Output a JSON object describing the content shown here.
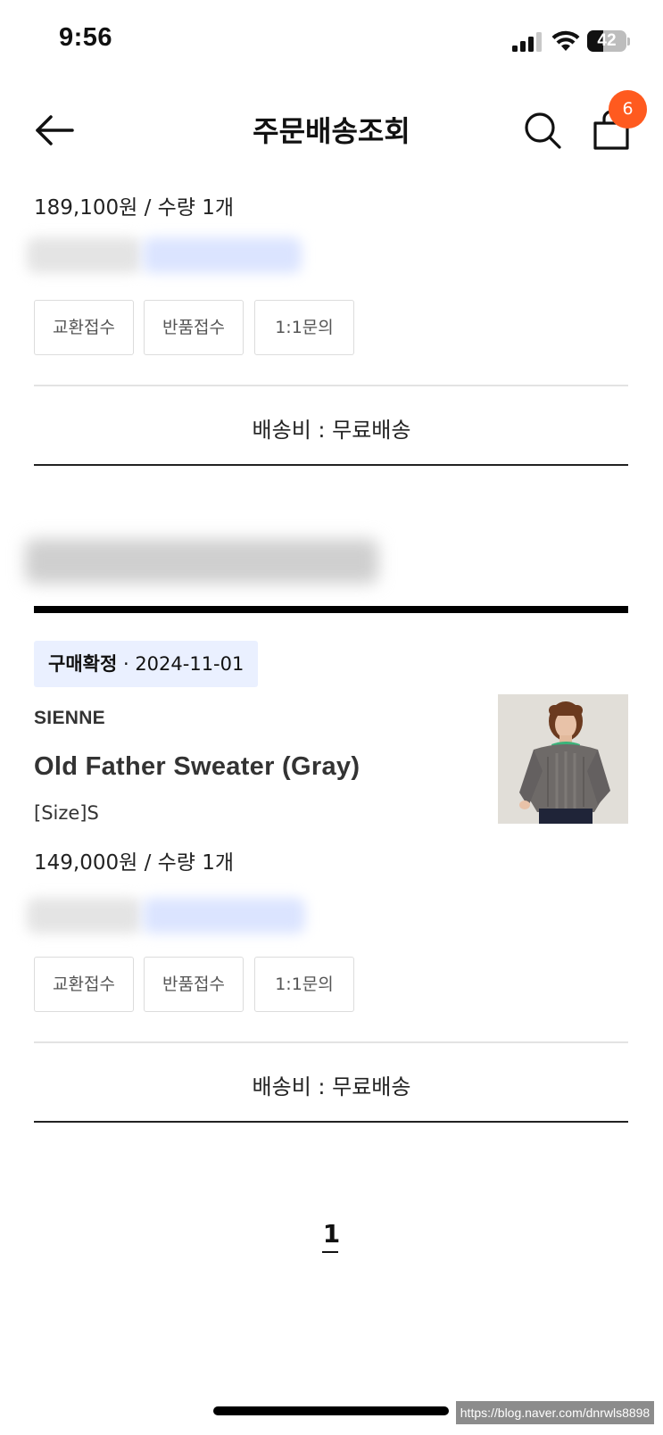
{
  "status_bar": {
    "time": "9:56",
    "battery": "42",
    "battery_level": 0.42,
    "icons": [
      "cellular-signal-icon",
      "wifi-icon",
      "battery-icon"
    ]
  },
  "header": {
    "title": "주문배송조회",
    "back_icon": "arrow-left-icon",
    "search_icon": "search-icon",
    "bag_icon": "shopping-bag-icon",
    "cart_count": "6"
  },
  "orders": [
    {
      "price_line": "189,100원 / 수량 1개",
      "buttons": [
        "교환접수",
        "반품접수",
        "1:1문의"
      ],
      "shipping": "배송비 : 무료배송"
    },
    {
      "status": "구매확정",
      "status_date": "· 2024-11-01",
      "brand": "SIENNE",
      "product_name": "Old Father Sweater (Gray)",
      "option": "[Size]S",
      "price_line": "149,000원 / 수량 1개",
      "buttons": [
        "교환접수",
        "반품접수",
        "1:1문의"
      ],
      "shipping": "배송비 : 무료배송"
    }
  ],
  "pagination": {
    "current": "1"
  },
  "watermark": "https://blog.naver.com/dnrwls8898",
  "colors": {
    "badge": "#ff5a1f",
    "status_chip_bg": "#eaf0ff",
    "redacted_link": "#dbe4ff"
  }
}
